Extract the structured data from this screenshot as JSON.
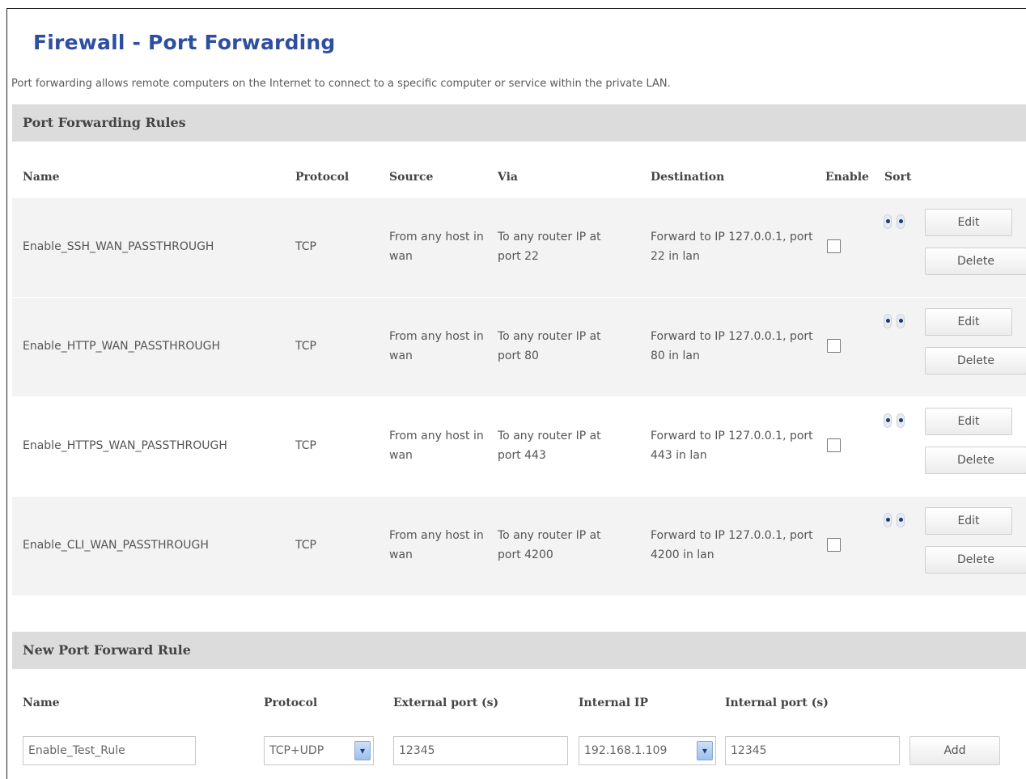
{
  "page": {
    "title": "Firewall - Port Forwarding",
    "description": "Port forwarding allows remote computers on the Internet to connect to a specific computer or service within the private LAN."
  },
  "rules_section": {
    "title": "Port Forwarding Rules",
    "columns": {
      "name": "Name",
      "protocol": "Protocol",
      "source": "Source",
      "via": "Via",
      "destination": "Destination",
      "enable": "Enable",
      "sort": "Sort"
    },
    "rules": [
      {
        "name": "Enable_SSH_WAN_PASSTHROUGH",
        "protocol": "TCP",
        "source": "From any host in wan",
        "via": "To any router IP at port 22",
        "destination": "Forward to IP 127.0.0.1, port 22 in lan",
        "enabled": false,
        "edit_label": "Edit",
        "delete_label": "Delete"
      },
      {
        "name": "Enable_HTTP_WAN_PASSTHROUGH",
        "protocol": "TCP",
        "source": "From any host in wan",
        "via": "To any router IP at port 80",
        "destination": "Forward to IP 127.0.0.1, port 80 in lan",
        "enabled": false,
        "edit_label": "Edit",
        "delete_label": "Delete"
      },
      {
        "name": "Enable_HTTPS_WAN_PASSTHROUGH",
        "protocol": "TCP",
        "source": "From any host in wan",
        "via": "To any router IP at port 443",
        "destination": "Forward to IP 127.0.0.1, port 443 in lan",
        "enabled": false,
        "edit_label": "Edit",
        "delete_label": "Delete"
      },
      {
        "name": "Enable_CLI_WAN_PASSTHROUGH",
        "protocol": "TCP",
        "source": "From any host in wan",
        "via": "To any router IP at port 4200",
        "destination": "Forward to IP 127.0.0.1, port 4200 in lan",
        "enabled": false,
        "edit_label": "Edit",
        "delete_label": "Delete"
      }
    ]
  },
  "new_rule_section": {
    "title": "New Port Forward Rule",
    "columns": {
      "name": "Name",
      "protocol": "Protocol",
      "external_port": "External port (s)",
      "internal_ip": "Internal IP",
      "internal_port": "Internal port (s)"
    },
    "form": {
      "name_value": "Enable_Test_Rule",
      "protocol_value": "TCP+UDP",
      "external_port_value": "12345",
      "internal_ip_value": "192.168.1.109",
      "internal_port_value": "12345",
      "add_label": "Add"
    }
  },
  "icons": {
    "sort_up": "sort-up-icon",
    "sort_down": "sort-down-icon",
    "dropdown": "chevron-down-icon"
  },
  "colors": {
    "title": "#2e4fa0",
    "section_header_bg": "#dcdcdc",
    "row_shade": "#f3f3f3"
  }
}
